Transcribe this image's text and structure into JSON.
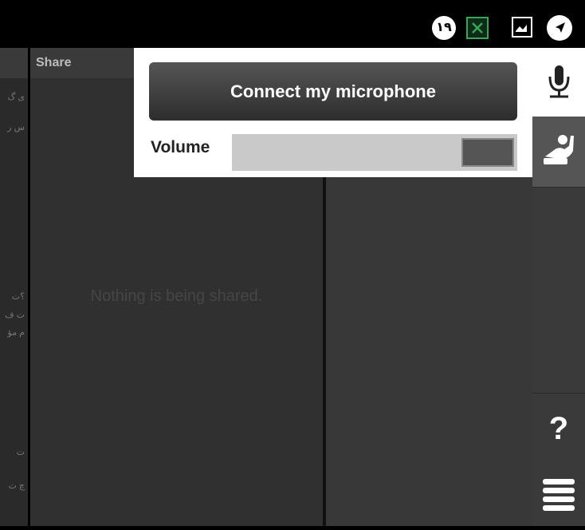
{
  "status_bar": {
    "badge_text": "۱۹",
    "icons": [
      "notification-badge",
      "vpn-icon",
      "image-icon",
      "navigation-icon"
    ]
  },
  "left_strip": {
    "fragments": [
      "ی گ",
      "س ر",
      "؟ت",
      "ت ف",
      "م مؤ",
      "ت",
      "چ ت"
    ]
  },
  "share_panel": {
    "header": "Share",
    "empty_message": "Nothing is being shared."
  },
  "audio_popup": {
    "connect_button": "Connect my microphone",
    "volume_label": "Volume",
    "volume_level": 0.82
  },
  "sidebar": {
    "buttons": [
      "microphone-icon",
      "raise-hand-icon",
      "help-icon",
      "menu-icon"
    ],
    "help_label": "?"
  },
  "colors": {
    "background": "#000000",
    "panel": "#303030",
    "popup": "#ffffff",
    "button_dark": "#3a3a3a"
  }
}
